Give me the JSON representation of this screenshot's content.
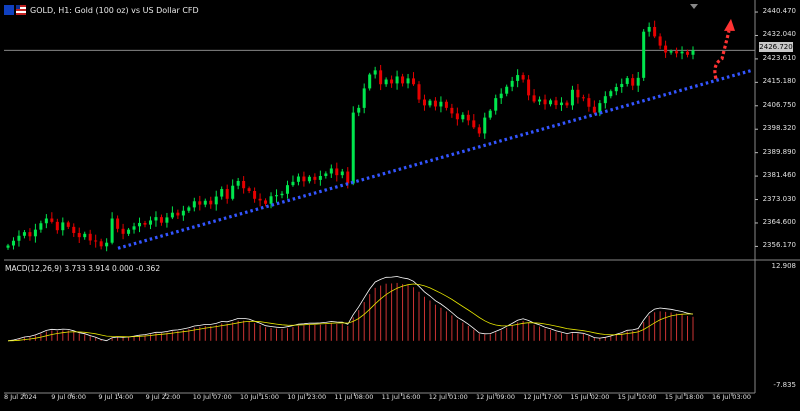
{
  "window": {
    "title": "GOLD, H1:  Gold (100 oz) vs US Dollar CFD",
    "flag_icon": "eu-us-flag-icon"
  },
  "price_axis": {
    "labels": [
      "2440.470",
      "2432.040",
      "2423.610",
      "2415.180",
      "2406.750",
      "2398.320",
      "2389.890",
      "2381.460",
      "2373.030",
      "2364.600",
      "2356.170"
    ],
    "current_price": "2426.720"
  },
  "macd": {
    "label": "MACD(12,26,9) 3.733 3.914 0.000 -0.362",
    "axis_top": "12.908",
    "axis_bottom": "-7.835"
  },
  "time_axis": {
    "labels": [
      "8 Jul 2024",
      "9 Jul 06:00",
      "9 Jul 14:00",
      "9 Jul 22:00",
      "10 Jul 07:00",
      "10 Jul 15:00",
      "10 Jul 23:00",
      "11 Jul 08:00",
      "11 Jul 16:00",
      "12 Jul 01:00",
      "12 Jul 09:00",
      "12 Jul 17:00",
      "15 Jul 02:00",
      "15 Jul 10:00",
      "15 Jul 18:00",
      "16 Jul 03:00"
    ]
  },
  "colors": {
    "bull": "#00e64d",
    "bear": "#e60000",
    "trendline": "#3355ff",
    "forecast_arrow": "#ff3333",
    "macd_line": "#ffffff",
    "signal_line": "#e6e600",
    "hist_pos": "#cc3333",
    "hist_neg": "#33a8cc"
  },
  "chart_data": {
    "type": "candlestick",
    "timeframe": "H1",
    "symbol": "GOLD",
    "ylim": [
      2352,
      2443
    ],
    "close_series": [
      2356.5,
      2358.2,
      2360.0,
      2361.3,
      2359.8,
      2362.2,
      2364.5,
      2366.2,
      2365.0,
      2362.0,
      2364.8,
      2363.2,
      2361.0,
      2359.5,
      2360.7,
      2358.3,
      2358.0,
      2356.2,
      2357.5,
      2366.2,
      2362.5,
      2360.7,
      2362.2,
      2363.4,
      2364.6,
      2364.0,
      2365.5,
      2366.7,
      2364.7,
      2366.6,
      2368.3,
      2367.3,
      2369.0,
      2370.2,
      2372.4,
      2371.2,
      2372.6,
      2371.3,
      2374.1,
      2376.8,
      2373.3,
      2378.0,
      2379.7,
      2377.1,
      2376.1,
      2373.3,
      2372.7,
      2371.5,
      2374.2,
      2374.6,
      2375.1,
      2378.2,
      2379.4,
      2381.3,
      2379.6,
      2381.2,
      2380.1,
      2381.5,
      2382.4,
      2384.2,
      2381.8,
      2383.1,
      2378.8,
      2404.3,
      2406.0,
      2413.0,
      2418.0,
      2419.5,
      2414.5,
      2416.2,
      2414.8,
      2417.3,
      2414.8,
      2416.6,
      2414.5,
      2409.0,
      2406.9,
      2408.6,
      2406.5,
      2408.2,
      2406.0,
      2404.0,
      2401.9,
      2403.5,
      2401.5,
      2399.0,
      2396.8,
      2402.5,
      2405.0,
      2409.5,
      2411.1,
      2413.6,
      2415.7,
      2417.8,
      2416.2,
      2410.5,
      2408.3,
      2409.0,
      2407.3,
      2408.7,
      2407.0,
      2407.9,
      2406.9,
      2412.5,
      2409.8,
      2409.5,
      2406.4,
      2404.3,
      2407.7,
      2410.2,
      2412.0,
      2413.5,
      2414.6,
      2416.7,
      2414.0,
      2416.8,
      2433.4,
      2435.1,
      2431.7,
      2428.4,
      2425.9,
      2426.4,
      2425.6,
      2426.2,
      2425.1,
      2426.7
    ],
    "trendline": {
      "from": {
        "x": "9 Jul 14:00",
        "y": 2355.5
      },
      "to": {
        "x": "16 Jul 06:00",
        "y": 2419.5
      }
    },
    "forecast_arrow": {
      "direction": "up",
      "from": 2416.5,
      "to": 2438.0
    },
    "macd": {
      "params": [
        12,
        26,
        9
      ],
      "macd_value": 3.733,
      "signal_value": 3.914,
      "histogram": 0.0,
      "last": -0.362,
      "ylim": [
        -7.835,
        12.908
      ]
    }
  }
}
